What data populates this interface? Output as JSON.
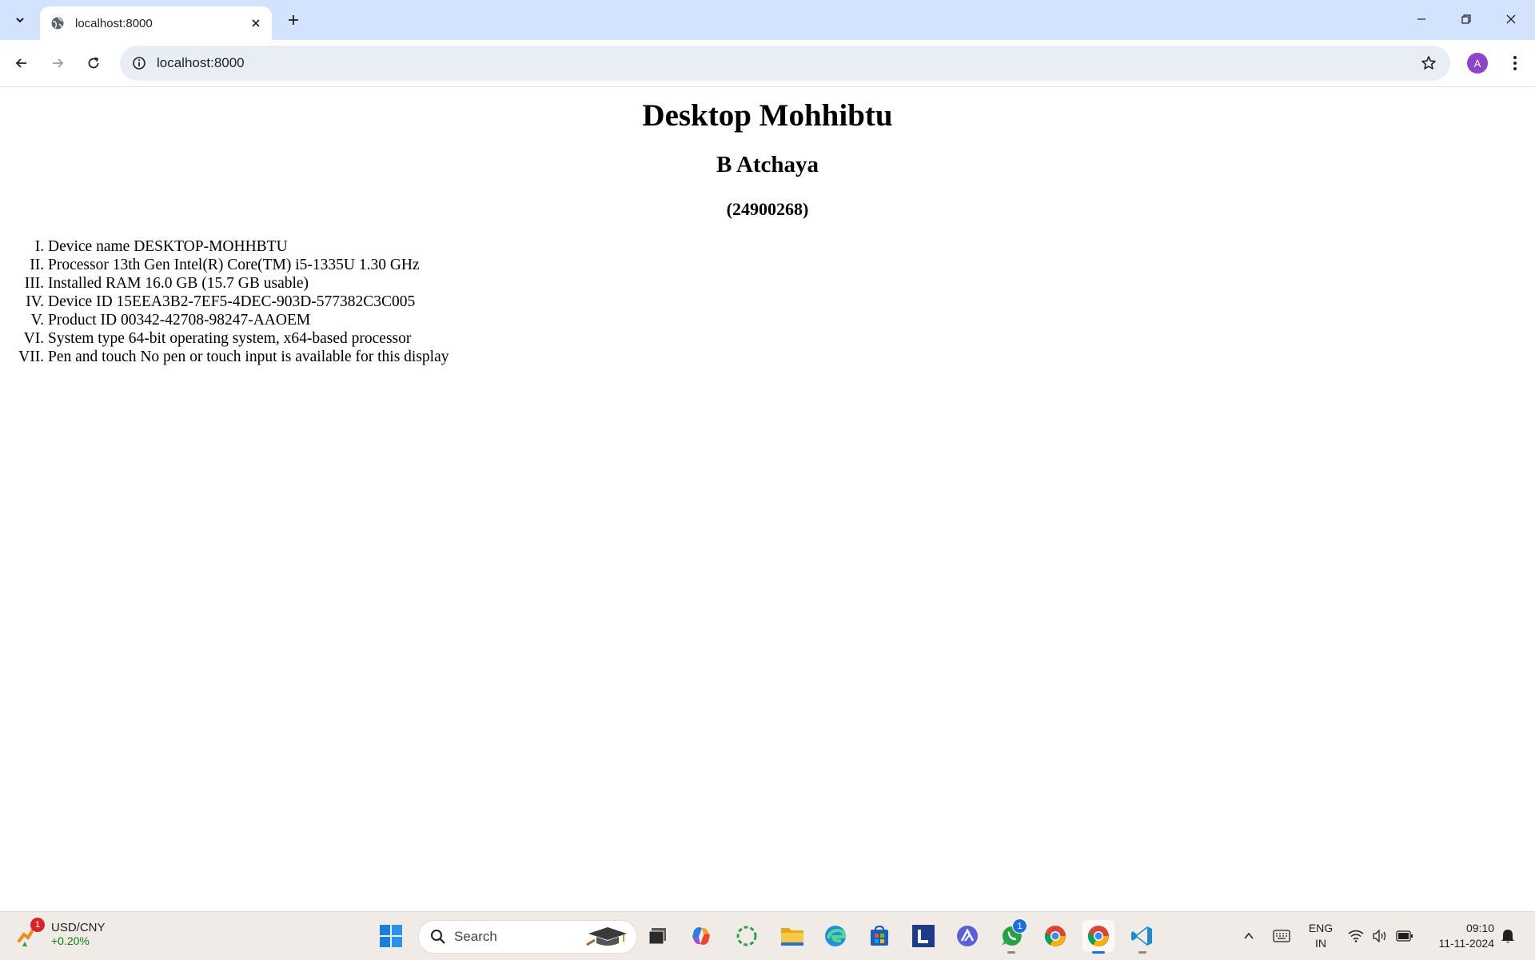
{
  "browser": {
    "tab_title": "localhost:8000",
    "url": "localhost:8000",
    "profile_initial": "A",
    "colors": {
      "tabstrip": "#d3e3fd",
      "omnibox": "#e9eef6",
      "avatar": "#8e44c8"
    }
  },
  "page": {
    "title": "Desktop Mohhibtu",
    "author": "B Atchaya",
    "id": "(24900268)",
    "specs": [
      "Device name DESKTOP-MOHHBTU",
      "Processor 13th Gen Intel(R) Core(TM) i5-1335U 1.30 GHz",
      "Installed RAM 16.0 GB (15.7 GB usable)",
      "Device ID 15EEA3B2-7EF5-4DEC-903D-577382C3C005",
      "Product ID 00342-42708-98247-AAOEM",
      "System type 64-bit operating system, x64-based processor",
      "Pen and touch No pen or touch input is available for this display"
    ]
  },
  "taskbar": {
    "widget": {
      "title": "USD/CNY",
      "value": "+0.20%",
      "badge": "1"
    },
    "search_placeholder": "Search",
    "whatsapp_badge": "1",
    "pinned_icons": [
      "windows-start-icon",
      "search-icon",
      "file-explorer-dark-icon",
      "copilot-icon",
      "refresh-app-icon",
      "folder-icon",
      "edge-icon",
      "store-icon",
      "l-app-icon",
      "triangle-app-icon",
      "whatsapp-icon",
      "chrome-icon",
      "chrome-active-icon",
      "vscode-icon"
    ],
    "tray": {
      "lang_line1": "ENG",
      "lang_line2": "IN",
      "time": "09:10",
      "date": "11-11-2024"
    }
  }
}
